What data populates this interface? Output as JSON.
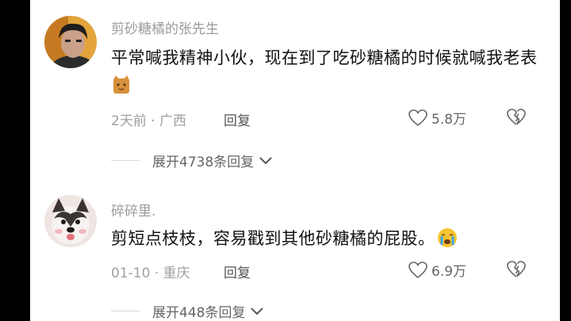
{
  "comments": [
    {
      "username": "剪砂糖橘的张先生",
      "text": "平常喊我精神小伙，现在到了吃砂糖橘的时候就喊我老表",
      "emoji": "cat-emoji",
      "time": "2天前",
      "location": "广西",
      "reply_label": "回复",
      "likes": "5.8万",
      "expand_label": "展开4738条回复"
    },
    {
      "username": "碎碎里.",
      "text": "剪短点枝枝，容易戳到其他砂糖橘的屁股。",
      "emoji": "crying-emoji",
      "time": "01-10",
      "location": "重庆",
      "reply_label": "回复",
      "likes": "6.9万",
      "expand_label": "展开448条回复"
    }
  ],
  "colors": {
    "username": "#9b9b9b",
    "text": "#111111",
    "meta": "#a0a0a0",
    "background": "#ffffff",
    "letterbox": "#000000"
  }
}
